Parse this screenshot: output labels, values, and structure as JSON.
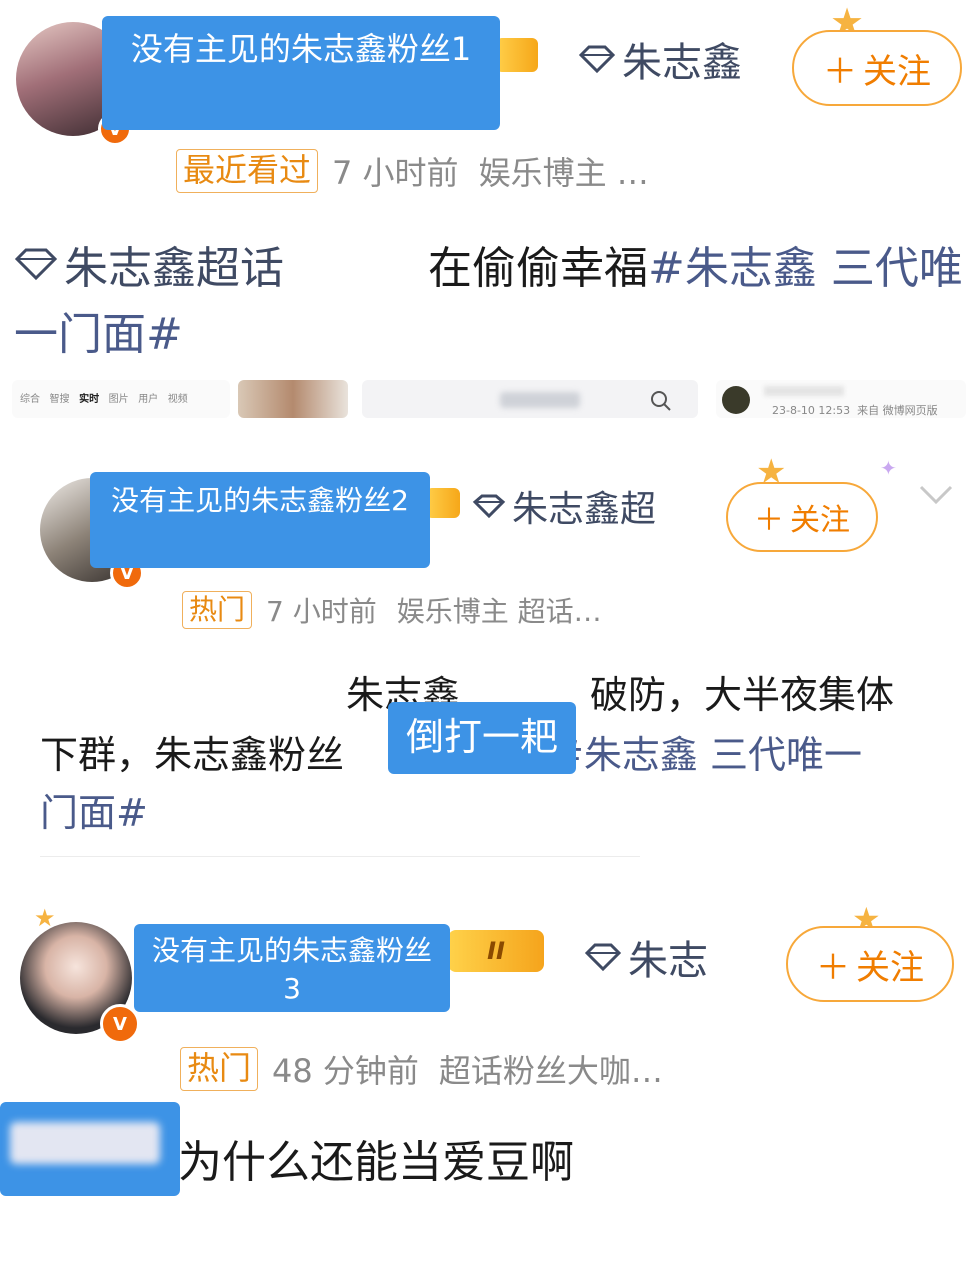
{
  "posts": [
    {
      "overlay_name": "没有主见的朱志鑫粉丝1",
      "topic_chip": "朱志鑫",
      "follow_label": "关注",
      "tag": "最近看过",
      "time": "7 小时前",
      "role": "娱乐博主 …",
      "supertopic": "朱志鑫超话",
      "text_line1": "在偷偷幸福",
      "hashtag_line1": "#朱志鑫 三代唯",
      "hashtag_line2": "一门面#"
    },
    {
      "overlay_name": "没有主见的朱志鑫粉丝2",
      "topic_chip": "朱志鑫超",
      "follow_label": "关注",
      "tag": "热门",
      "time": "7 小时前",
      "role": "娱乐博主 超话…",
      "text_line1_a": "朱志鑫",
      "text_line1_b": "破防，大半夜集体",
      "text_line2_a": "下群，",
      "text_line2_b": "朱志鑫粉丝",
      "overlay_word": "倒打一耙",
      "hashtag_line2": "#朱志鑫 三代唯一",
      "hashtag_line3": "门面#"
    },
    {
      "overlay_name": "没有主见的朱志鑫粉丝3",
      "topic_chip": "朱志",
      "follow_label": "关注",
      "tag": "热门",
      "time": "48 分钟前",
      "role": "超话粉丝大咖…",
      "level": "II",
      "text_line1": "为什么还能当爱豆啊"
    }
  ],
  "thumbnail_strip": {
    "tabs": [
      "综合",
      "智搜",
      "实时",
      "图片",
      "用户",
      "视频"
    ],
    "timestamp": "23-8-10 12:53",
    "source": "来自 微博网页版"
  },
  "colors": {
    "overlay_blue": "#3d93e6",
    "follow_orange": "#f07d00",
    "hashtag": "#4a5a8a"
  }
}
